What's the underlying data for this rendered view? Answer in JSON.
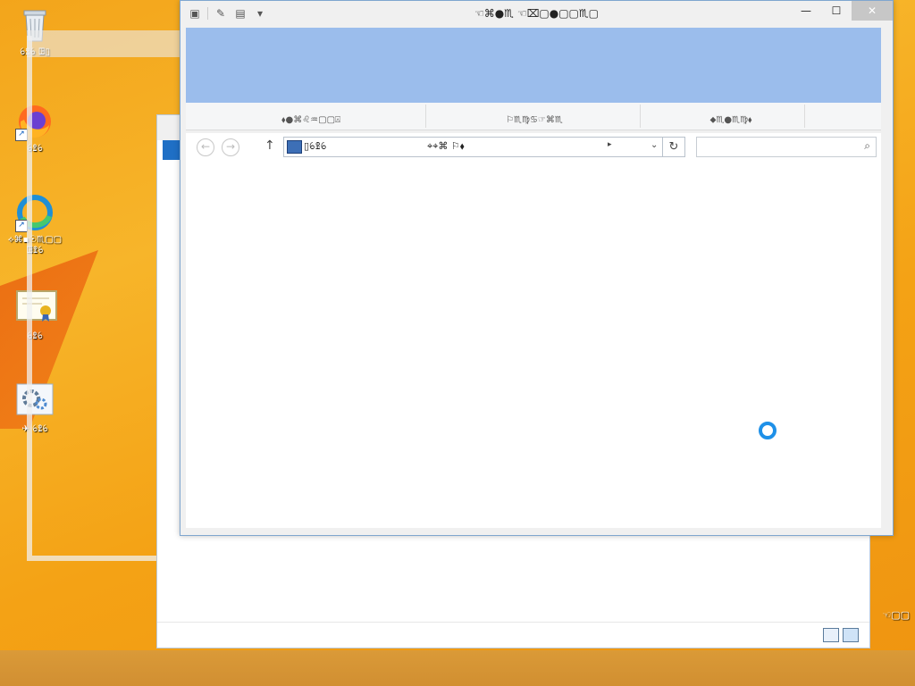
{
  "desktop": {
    "icons": [
      {
        "name": "recycle-bin",
        "label": "ꕃꖵꕃ ꖸ▯",
        "icon": "recycle-bin-icon"
      },
      {
        "name": "firefox",
        "label": "ꕃꖵꕃ",
        "icon": "firefox-icon"
      },
      {
        "name": "edge",
        "label": "⟡⌘▪☉♏▢▢ ꖸꖵꕃ",
        "icon": "edge-icon"
      },
      {
        "name": "certificate",
        "label": "ꕃꖵꕃ",
        "icon": "certificate-icon"
      },
      {
        "name": "settings",
        "label": "✈ ꕃꖵꕃ",
        "icon": "gear-icon"
      }
    ]
  },
  "explorer": {
    "title": "☜⌘●♏ ☜⌧▢●▢▢♏▢",
    "quick_access": [
      "window-icon",
      "properties-icon",
      "folder-icon",
      "chevron-down-icon"
    ],
    "window_buttons": {
      "minimize": "—",
      "maximize": "☐",
      "close": "✕"
    },
    "ribbon_groups": [
      "⬧●⌘♌♒▢▢⍓",
      "⚐♏♍♋☞⌘♏",
      "⬥♏●♏♍⬧"
    ],
    "nav": {
      "back": "←",
      "forward": "→",
      "up": "↑",
      "address_root": "▯ꕃꖵꕃ",
      "address_location": "⌖⌖⌘ ⚐⬧",
      "address_arrow": "▸",
      "address_dropdown": "⌄",
      "refresh": "↻"
    },
    "search": {
      "placeholder": "",
      "icon": "search-icon"
    },
    "loading": true
  },
  "background_window": {
    "view_buttons": [
      "details-view-icon",
      "large-icons-view-icon"
    ]
  },
  "tray": {
    "label": "☜▢▢"
  }
}
